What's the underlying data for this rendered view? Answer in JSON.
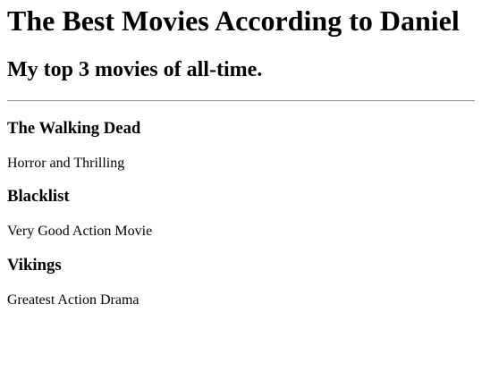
{
  "page": {
    "title": "The Best Movies According to Daniel",
    "subtitle": "My top 3 movies of all-time."
  },
  "movies": [
    {
      "title": "The Walking Dead",
      "description": "Horror and Thrilling"
    },
    {
      "title": "Blacklist",
      "description": "Very Good Action Movie"
    },
    {
      "title": "Vikings",
      "description": "Greatest Action Drama"
    }
  ]
}
